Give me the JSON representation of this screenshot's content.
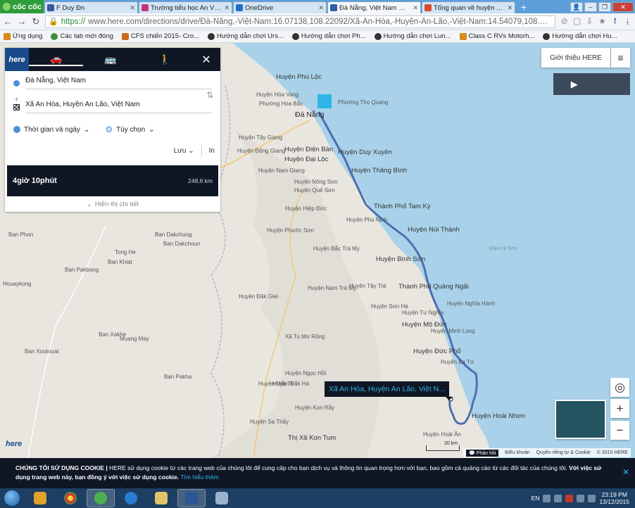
{
  "browser": {
    "brand": "cốc cốc",
    "tabs": [
      {
        "title": "F Duy Ðn",
        "color": "#3b5998"
      },
      {
        "title": "Trường tiểu học An Vinh, A",
        "color": "#c2357a"
      },
      {
        "title": "OneDrive",
        "color": "#1e6fc7"
      },
      {
        "title": "Đà Nẵng, Việt Nam — Xã A",
        "color": "#2a5ea8"
      },
      {
        "title": "Tổng quan về huyện An Lã",
        "color": "#d94a2f"
      }
    ],
    "url_proto": "https://",
    "url_rest": "www.here.com/directions/drive/Đà-Nẵng,-Việt-Nam:16.07138,108.22092/Xã-An-Hòa,-Huyện-An-Lão,-Việt-Nam:14.54079,108.9058?m",
    "bookmarks": [
      "Ứng dụng",
      "Các tab mới đóng",
      "CFS chiến 2015- Cro...",
      "Hướng dẫn chơi Urs...",
      "Hướng dẫn chơi Ph...",
      "Hướng dẫn chơi Lun...",
      "Class C RVs Motorh...",
      "Hướng dẫn chơi Hu..."
    ]
  },
  "panel": {
    "logo": "here",
    "origin": "Đà Nẵng, Việt Nam",
    "destination": "Xã An Hòa, Huyện An Lão, Việt Nam",
    "time_option": "Thời gian và ngày",
    "custom_option": "Tùy chọn",
    "save": "Lưu",
    "print": "In",
    "duration": "4giờ 10phút",
    "distance": "248,6 km",
    "show_details": "Hiển thị chi tiết"
  },
  "controls": {
    "intro": "Giới thiệu HERE",
    "zoom_in": "+",
    "zoom_out": "−"
  },
  "map": {
    "callout": "Xã An Hòa, Huyện An Lão, Việt N...",
    "scale": "20 km",
    "footer_feedback": "Phản hồi",
    "footer_terms": "Điều khoản",
    "footer_privacy": "Quyền riêng tư & Cookie",
    "footer_copy": "© 2015 HERE",
    "watermark": "here",
    "places": [
      {
        "t": "Huyện Phú Lộc",
        "c": "big"
      },
      {
        "t": "Đà Nẵng",
        "c": "city"
      },
      {
        "t": "Huyện Điện Bàn",
        "c": "big"
      },
      {
        "t": "Huyện Duy Xuyên",
        "c": "big"
      },
      {
        "t": "Huyện Đại Lộc",
        "c": "big"
      },
      {
        "t": "Huyện Thăng Bình",
        "c": "big"
      },
      {
        "t": "Thành Phố Tam Kỳ",
        "c": "big"
      },
      {
        "t": "Huyện Núi Thành",
        "c": "big"
      },
      {
        "t": "Huyện Bình Sơn",
        "c": "big"
      },
      {
        "t": "Thành Phố Quảng Ngãi",
        "c": "big"
      },
      {
        "t": "Huyện Mộ Đức",
        "c": "big"
      },
      {
        "t": "Huyện Đức Phổ",
        "c": "big"
      },
      {
        "t": "Huyện Hoài Nhơn",
        "c": "big"
      },
      {
        "t": "Thị Xã Kon Tum",
        "c": "big"
      },
      {
        "t": "Huyện Phú Ninh",
        "c": ""
      },
      {
        "t": "Huyện Nông Sơn",
        "c": ""
      },
      {
        "t": "Huyện Quế Sơn",
        "c": ""
      },
      {
        "t": "Huyện Hiệp Đức",
        "c": ""
      },
      {
        "t": "Huyện Phước Sơn",
        "c": ""
      },
      {
        "t": "Huyện Bắc Trà My",
        "c": ""
      },
      {
        "t": "Huyện Nam Trà My",
        "c": ""
      },
      {
        "t": "Huyện Tây Trà",
        "c": ""
      },
      {
        "t": "Huyện Sơn Hà",
        "c": ""
      },
      {
        "t": "Huyện Đăk Glei",
        "c": ""
      },
      {
        "t": "Xã Tu Mơ Rông",
        "c": ""
      },
      {
        "t": "Huyện Ngọc Hồi",
        "c": ""
      },
      {
        "t": "Huyện Đắk Tô",
        "c": ""
      },
      {
        "t": "Huyện Đắk Hà",
        "c": ""
      },
      {
        "t": "Huyện Kon Rẫy",
        "c": ""
      },
      {
        "t": "Huyện Sa Thầy",
        "c": ""
      },
      {
        "t": "Huyện Hoài Ân",
        "c": ""
      },
      {
        "t": "Huyện Ba Tơ",
        "c": ""
      },
      {
        "t": "Huyện Nam Giang",
        "c": ""
      },
      {
        "t": "Huyện Tây Giang",
        "c": ""
      },
      {
        "t": "Huyện Đông Giang",
        "c": ""
      },
      {
        "t": "Huyện Nghĩa Hành",
        "c": ""
      },
      {
        "t": "Huyện Minh Long",
        "c": ""
      },
      {
        "t": "Huyện Tư Nghĩa",
        "c": ""
      },
      {
        "t": "Ban Phon",
        "c": ""
      },
      {
        "t": "Ban Dakchung",
        "c": ""
      },
      {
        "t": "Ban Dakchoun",
        "c": ""
      },
      {
        "t": "Tong He",
        "c": ""
      },
      {
        "t": "Ban Khiat",
        "c": ""
      },
      {
        "t": "Ban Pakbong",
        "c": ""
      },
      {
        "t": "Houaykong",
        "c": ""
      },
      {
        "t": "Ban Xakhe",
        "c": ""
      },
      {
        "t": "Muang May",
        "c": ""
      },
      {
        "t": "Ban Xoutouat",
        "c": ""
      },
      {
        "t": "Ban Pakha",
        "c": ""
      },
      {
        "t": "Đảo Lý Sơn",
        "c": "sea"
      },
      {
        "t": "Phường Thọ Quang",
        "c": ""
      },
      {
        "t": "Huyện Hòa Vang",
        "c": ""
      },
      {
        "t": "Phường Hòa Bắc",
        "c": ""
      }
    ]
  },
  "cookie": {
    "title": "CHÚNG TÔI SỬ DỤNG COOKIE |",
    "body": " HERE sử dụng cookie từ các trang web của chúng tôi để cung cấp cho bạn dịch vụ và thông tin quan trọng hơn với bạn, bao gồm cả quảng cáo từ các đối tác của chúng tôi. ",
    "bold2": "Với việc sử dụng trang web này, bạn đồng ý với việc sử dụng cookie.",
    "link": " Tìm hiểu thêm"
  },
  "taskbar": {
    "lang": "EN",
    "time": "23:19 PM",
    "date": "13/12/2015"
  }
}
